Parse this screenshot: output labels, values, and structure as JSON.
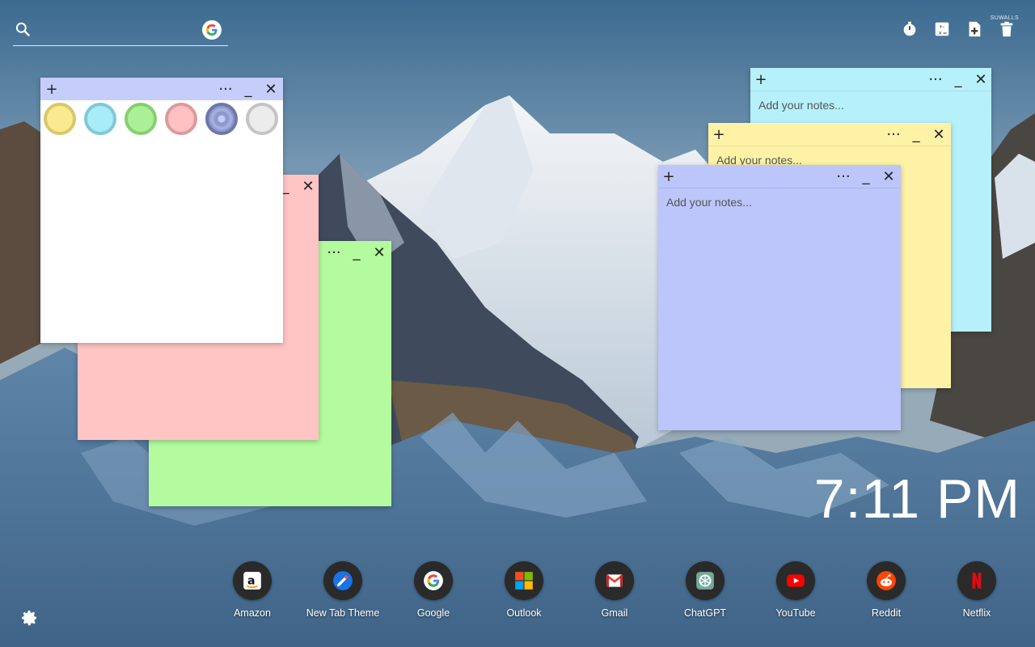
{
  "search": {
    "placeholder": ""
  },
  "brand": "SUWALLS",
  "tools": [
    {
      "name": "timer-icon"
    },
    {
      "name": "calculator-icon"
    },
    {
      "name": "add-note-icon"
    },
    {
      "name": "trash-icon"
    }
  ],
  "notes": {
    "plus": "+",
    "menu": "···",
    "minimize": "_",
    "close": "✕",
    "placeholder": "Add your notes..."
  },
  "colors": {
    "white": "#ffffff",
    "pink": "#ffc4c4",
    "green": "#b3fb9e",
    "cyan": "#b6f0fb",
    "yellow": "#fdf2a6",
    "lavender": "#bcc6fb",
    "bar_white": "#c5cdfb"
  },
  "swatches": [
    {
      "fill": "#fbe98f",
      "ring": "#d8c86b"
    },
    {
      "fill": "#a8ecf8",
      "ring": "#7fc9d8"
    },
    {
      "fill": "#a9f096",
      "ring": "#86cf71"
    },
    {
      "fill": "#ffc1c1",
      "ring": "#dc9a9a"
    },
    {
      "fill": "#8e99cc",
      "ring": "#6e78a8"
    },
    {
      "fill": "#ececec",
      "ring": "#c4c4c4"
    }
  ],
  "clock": "7:11 PM",
  "apps": [
    {
      "label": "Amazon",
      "icon": "amazon-icon"
    },
    {
      "label": "New Tab Theme",
      "icon": "new-tab-theme-icon"
    },
    {
      "label": "Google",
      "icon": "google-icon"
    },
    {
      "label": "Outlook",
      "icon": "outlook-icon"
    },
    {
      "label": "Gmail",
      "icon": "gmail-icon"
    },
    {
      "label": "ChatGPT",
      "icon": "chatgpt-icon"
    },
    {
      "label": "YouTube",
      "icon": "youtube-icon"
    },
    {
      "label": "Reddit",
      "icon": "reddit-icon"
    },
    {
      "label": "Netflix",
      "icon": "netflix-icon"
    }
  ]
}
